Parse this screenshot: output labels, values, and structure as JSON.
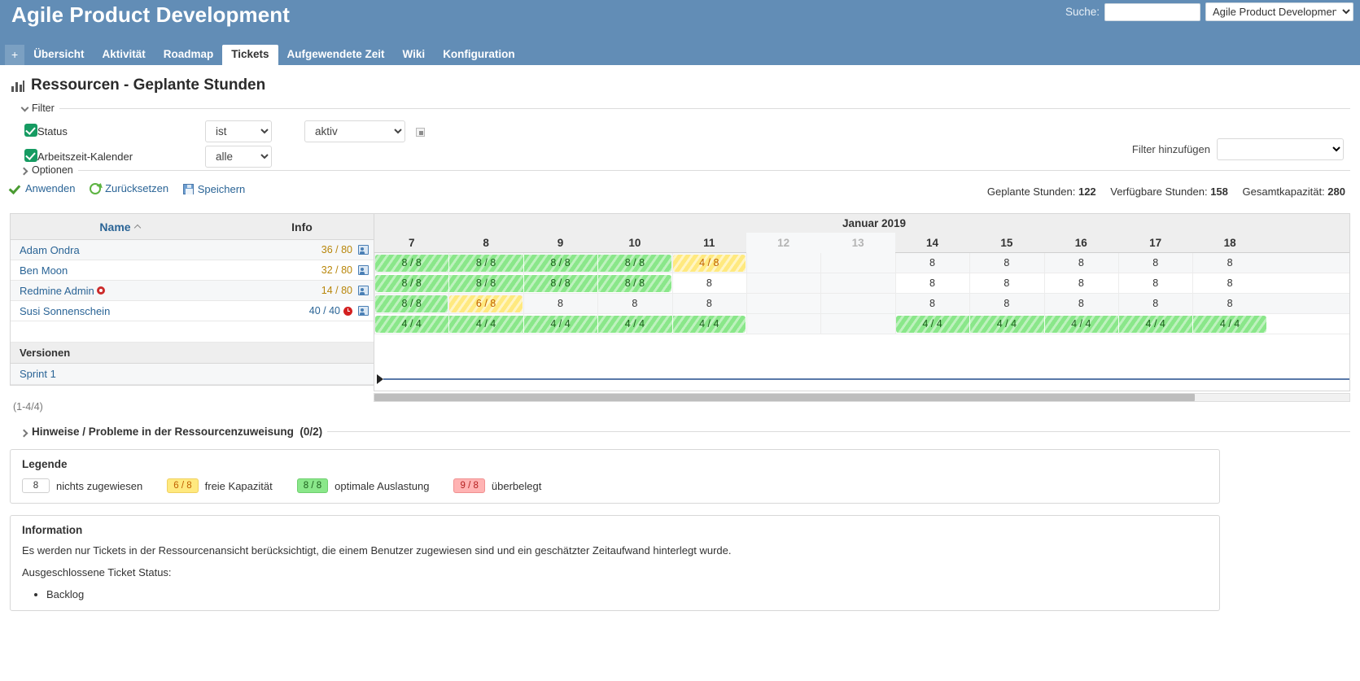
{
  "header": {
    "app_title": "Agile Product Development",
    "search_label": "Suche:",
    "search_value": "",
    "search_placeholder": "",
    "project_selected": "Agile Product Development"
  },
  "mainmenu": {
    "plus_label": "+",
    "items": [
      {
        "label": "Übersicht",
        "selected": false
      },
      {
        "label": "Aktivität",
        "selected": false
      },
      {
        "label": "Roadmap",
        "selected": false
      },
      {
        "label": "Tickets",
        "selected": true
      },
      {
        "label": "Aufgewendete Zeit",
        "selected": false
      },
      {
        "label": "Wiki",
        "selected": false
      },
      {
        "label": "Konfiguration",
        "selected": false
      }
    ]
  },
  "page": {
    "title": "Ressourcen - Geplante Stunden",
    "counts": "(1-4/4)"
  },
  "filters": {
    "legend": "Filter",
    "rows": [
      {
        "name": "Status",
        "checked": true,
        "operator": "ist",
        "value": "aktiv",
        "has_toggle": true
      },
      {
        "name": "Arbeitszeit-Kalender",
        "checked": true,
        "operator": "alle",
        "value": null,
        "has_toggle": false
      }
    ],
    "add_filter_label": "Filter hinzufügen",
    "add_filter_value": ""
  },
  "options": {
    "legend": "Optionen"
  },
  "actions": {
    "apply": "Anwenden",
    "reset": "Zurücksetzen",
    "save": "Speichern"
  },
  "summary": {
    "planned_label": "Geplante Stunden:",
    "planned_value": "122",
    "available_label": "Verfügbare Stunden:",
    "available_value": "158",
    "capacity_label": "Gesamtkapazität:",
    "capacity_value": "280"
  },
  "table": {
    "col_name": "Name",
    "col_info": "Info",
    "group_versions": "Versionen",
    "version_name": "Sprint 1",
    "rows": [
      {
        "name": "Adam Ondra",
        "info": "36 / 80",
        "overload": false,
        "admin": false
      },
      {
        "name": "Ben Moon",
        "info": "32 / 80",
        "overload": false,
        "admin": false
      },
      {
        "name": "Redmine Admin",
        "info": "14 / 80",
        "overload": false,
        "admin": true
      },
      {
        "name": "Susi Sonnenschein",
        "info": "40 / 40",
        "overload": true,
        "admin": false
      }
    ]
  },
  "chart_data": {
    "type": "table",
    "title": "Ressourcen - Geplante Stunden",
    "month_label": "Januar 2019",
    "days": [
      {
        "day": "7",
        "weekend": false
      },
      {
        "day": "8",
        "weekend": false
      },
      {
        "day": "9",
        "weekend": false
      },
      {
        "day": "10",
        "weekend": false
      },
      {
        "day": "11",
        "weekend": false
      },
      {
        "day": "12",
        "weekend": true
      },
      {
        "day": "13",
        "weekend": true
      },
      {
        "day": "14",
        "weekend": false
      },
      {
        "day": "15",
        "weekend": false
      },
      {
        "day": "16",
        "weekend": false
      },
      {
        "day": "17",
        "weekend": false
      },
      {
        "day": "18",
        "weekend": false
      }
    ],
    "series": [
      {
        "name": "Adam Ondra",
        "cells": [
          {
            "day": "7",
            "text": "8 / 8",
            "state": "optimal"
          },
          {
            "day": "8",
            "text": "8 / 8",
            "state": "optimal"
          },
          {
            "day": "9",
            "text": "8 / 8",
            "state": "optimal"
          },
          {
            "day": "10",
            "text": "8 / 8",
            "state": "optimal"
          },
          {
            "day": "11",
            "text": "4 / 8",
            "state": "free"
          },
          {
            "day": "12",
            "text": "",
            "state": "weekend"
          },
          {
            "day": "13",
            "text": "",
            "state": "weekend"
          },
          {
            "day": "14",
            "text": "8",
            "state": "none"
          },
          {
            "day": "15",
            "text": "8",
            "state": "none"
          },
          {
            "day": "16",
            "text": "8",
            "state": "none"
          },
          {
            "day": "17",
            "text": "8",
            "state": "none"
          },
          {
            "day": "18",
            "text": "8",
            "state": "none"
          }
        ]
      },
      {
        "name": "Ben Moon",
        "cells": [
          {
            "day": "7",
            "text": "8 / 8",
            "state": "optimal"
          },
          {
            "day": "8",
            "text": "8 / 8",
            "state": "optimal"
          },
          {
            "day": "9",
            "text": "8 / 8",
            "state": "optimal"
          },
          {
            "day": "10",
            "text": "8 / 8",
            "state": "optimal"
          },
          {
            "day": "11",
            "text": "8",
            "state": "none"
          },
          {
            "day": "12",
            "text": "",
            "state": "weekend"
          },
          {
            "day": "13",
            "text": "",
            "state": "weekend"
          },
          {
            "day": "14",
            "text": "8",
            "state": "none"
          },
          {
            "day": "15",
            "text": "8",
            "state": "none"
          },
          {
            "day": "16",
            "text": "8",
            "state": "none"
          },
          {
            "day": "17",
            "text": "8",
            "state": "none"
          },
          {
            "day": "18",
            "text": "8",
            "state": "none"
          }
        ]
      },
      {
        "name": "Redmine Admin",
        "cells": [
          {
            "day": "7",
            "text": "8 / 8",
            "state": "optimal"
          },
          {
            "day": "8",
            "text": "6 / 8",
            "state": "free"
          },
          {
            "day": "9",
            "text": "8",
            "state": "none"
          },
          {
            "day": "10",
            "text": "8",
            "state": "none"
          },
          {
            "day": "11",
            "text": "8",
            "state": "none"
          },
          {
            "day": "12",
            "text": "",
            "state": "weekend"
          },
          {
            "day": "13",
            "text": "",
            "state": "weekend"
          },
          {
            "day": "14",
            "text": "8",
            "state": "none"
          },
          {
            "day": "15",
            "text": "8",
            "state": "none"
          },
          {
            "day": "16",
            "text": "8",
            "state": "none"
          },
          {
            "day": "17",
            "text": "8",
            "state": "none"
          },
          {
            "day": "18",
            "text": "8",
            "state": "none"
          }
        ]
      },
      {
        "name": "Susi Sonnenschein",
        "cells": [
          {
            "day": "7",
            "text": "4 / 4",
            "state": "optimal"
          },
          {
            "day": "8",
            "text": "4 / 4",
            "state": "optimal"
          },
          {
            "day": "9",
            "text": "4 / 4",
            "state": "optimal"
          },
          {
            "day": "10",
            "text": "4 / 4",
            "state": "optimal"
          },
          {
            "day": "11",
            "text": "4 / 4",
            "state": "optimal"
          },
          {
            "day": "12",
            "text": "",
            "state": "weekend"
          },
          {
            "day": "13",
            "text": "",
            "state": "weekend"
          },
          {
            "day": "14",
            "text": "4 / 4",
            "state": "optimal"
          },
          {
            "day": "15",
            "text": "4 / 4",
            "state": "optimal"
          },
          {
            "day": "16",
            "text": "4 / 4",
            "state": "optimal"
          },
          {
            "day": "17",
            "text": "4 / 4",
            "state": "optimal"
          },
          {
            "day": "18",
            "text": "4 / 4",
            "state": "optimal"
          }
        ]
      }
    ]
  },
  "hinweise": {
    "label": "Hinweise / Probleme in der Ressourcenzuweisung",
    "count": "(0/2)"
  },
  "legend_box": {
    "title": "Legende",
    "items": [
      {
        "chip": "8",
        "style": "none",
        "label": "nichts zugewiesen"
      },
      {
        "chip": "6 / 8",
        "style": "free",
        "label": "freie Kapazität"
      },
      {
        "chip": "8 / 8",
        "style": "optimal",
        "label": "optimale Auslastung"
      },
      {
        "chip": "9 / 8",
        "style": "over",
        "label": "überbelegt"
      }
    ]
  },
  "info_box": {
    "title": "Information",
    "paragraph1": "Es werden nur Tickets in der Ressourcenansicht berücksichtigt, die einem Benutzer zugewiesen sind und ein geschätzter Zeitaufwand hinterlegt wurde.",
    "paragraph2": "Ausgeschlossene Ticket Status:",
    "excluded": [
      "Backlog"
    ]
  },
  "colors": {
    "brand": "#628db6",
    "link": "#2a6496",
    "optimal": "#8ae78a",
    "free": "#ffe97f",
    "over": "#ffb3b3",
    "warn_text": "#b8860b"
  }
}
